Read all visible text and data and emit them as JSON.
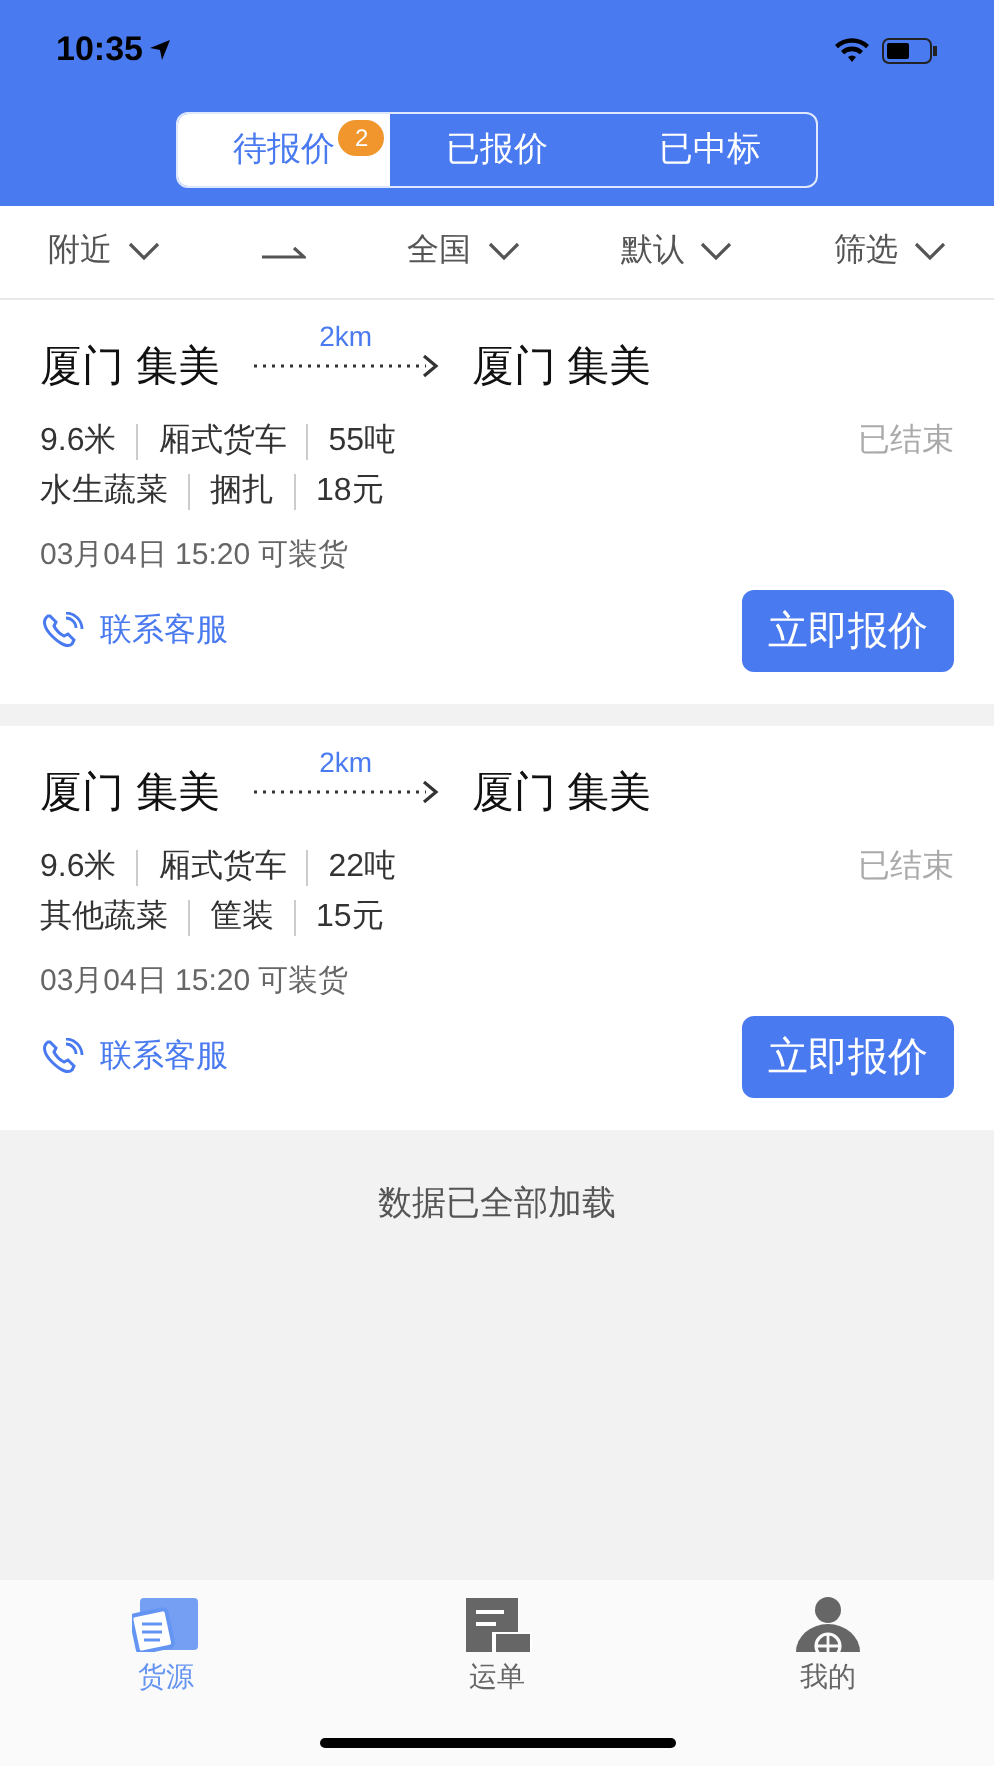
{
  "status_bar": {
    "time": "10:35"
  },
  "tabs": [
    {
      "label": "待报价",
      "selected": true,
      "badge": "2"
    },
    {
      "label": "已报价",
      "selected": false
    },
    {
      "label": "已中标",
      "selected": false
    }
  ],
  "filters": [
    {
      "label": "附近",
      "kind": "dropdown"
    },
    {
      "kind": "arrow"
    },
    {
      "label": "全国",
      "kind": "dropdown"
    },
    {
      "label": "默认",
      "kind": "dropdown"
    },
    {
      "label": "筛选",
      "kind": "dropdown"
    }
  ],
  "orders": [
    {
      "from": "厦门 集美",
      "distance": "2km",
      "to": "厦门 集美",
      "specs": [
        "9.6米",
        "厢式货车",
        "55吨"
      ],
      "goods": [
        "水生蔬菜",
        "捆扎",
        "18元"
      ],
      "status": "已结束",
      "load_time": "03月04日 15:20 可装货",
      "contact": "联系客服",
      "action": "立即报价"
    },
    {
      "from": "厦门 集美",
      "distance": "2km",
      "to": "厦门 集美",
      "specs": [
        "9.6米",
        "厢式货车",
        "22吨"
      ],
      "goods": [
        "其他蔬菜",
        "筐装",
        "15元"
      ],
      "status": "已结束",
      "load_time": "03月04日 15:20 可装货",
      "contact": "联系客服",
      "action": "立即报价"
    }
  ],
  "end_message": "数据已全部加载",
  "bottom_nav": [
    {
      "label": "货源",
      "selected": true,
      "kind": "cargo"
    },
    {
      "label": "运单",
      "selected": false,
      "kind": "waybill"
    },
    {
      "label": "我的",
      "selected": false,
      "kind": "profile"
    }
  ]
}
